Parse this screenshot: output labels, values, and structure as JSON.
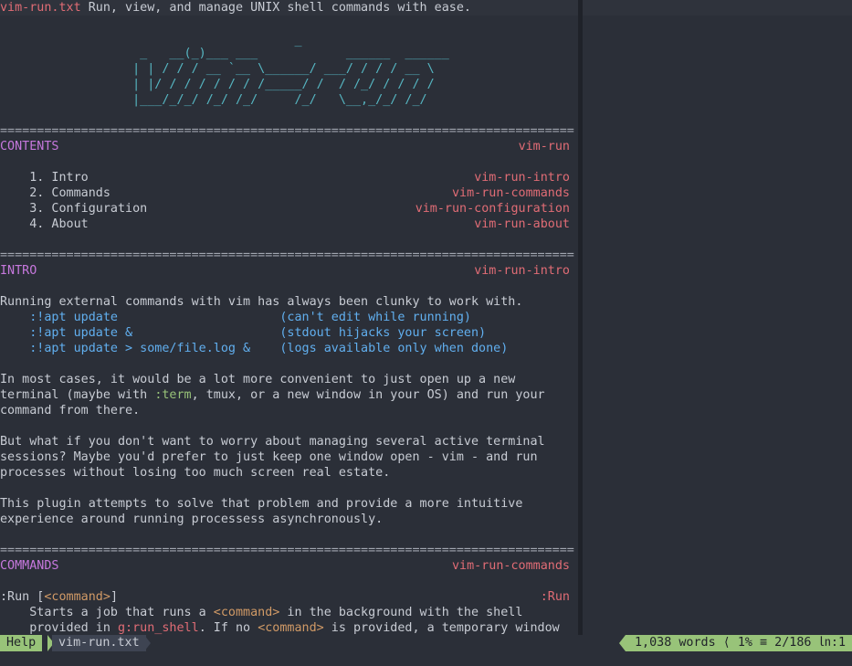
{
  "header": {
    "filename": "vim-run.txt",
    "description": " Run, view, and manage UNIX shell commands with ease."
  },
  "ascii_art": [
    "                                        _",
    "                   _   __(_)___ ___            ______  ______",
    "                  | | / / / __ `__ \\______/ ___/ / / / __ \\",
    "                  | |/ / / / / / / /_____/ /  / /_/ / / / /",
    "                  |___/_/_/ /_/ /_/     /_/   \\__,_/_/ /_/"
  ],
  "separator": "==============================================================================",
  "contents": {
    "title": "CONTENTS",
    "tag": "vim-run",
    "items": [
      {
        "label": "    1. Intro",
        "tag": "vim-run-intro"
      },
      {
        "label": "    2. Commands",
        "tag": "vim-run-commands"
      },
      {
        "label": "    3. Configuration",
        "tag": "vim-run-configuration"
      },
      {
        "label": "    4. About",
        "tag": "vim-run-about"
      }
    ]
  },
  "intro": {
    "title": "INTRO",
    "tag": "vim-run-intro",
    "p1": "Running external commands with vim has always been clunky to work with.",
    "examples": [
      {
        "cmd": "    :!apt update                      ",
        "note": "(can't edit while running)"
      },
      {
        "cmd": "    :!apt update &                    ",
        "note": "(stdout hijacks your screen)"
      },
      {
        "cmd": "    :!apt update > some/file.log &    ",
        "note": "(logs available only when done)"
      }
    ],
    "p2_l1": "In most cases, it would be a lot more convenient to just open up a new",
    "p2_l2_a": "terminal (maybe with ",
    "p2_l2_term": ":term",
    "p2_l2_b": ", tmux, or a new window in your OS) and run your",
    "p2_l3": "command from there.",
    "p3_l1": "But what if you don't want to worry about managing several active terminal",
    "p3_l2": "sessions? Maybe you'd prefer to just keep one window open - vim - and run",
    "p3_l3": "processes without losing too much screen real estate.",
    "p4_l1": "This plugin attempts to solve that problem and provide a more intuitive",
    "p4_l2": "experience around running processess asynchronously."
  },
  "commands": {
    "title": "COMMANDS",
    "tag": "vim-run-commands",
    "run_a": ":Run [",
    "run_arg": "<command>",
    "run_b": "]",
    "run_tag": ":Run",
    "d1_a": "    Starts a job that runs a ",
    "d1_arg": "<command>",
    "d1_b": " in the background with the shell",
    "d2_a": "    provided in ",
    "d2_var": "g:run_shell",
    "d2_b": ". If no ",
    "d2_arg": "<command>",
    "d2_c": " is provided, a temporary window"
  },
  "statusline": {
    "mode": "Help",
    "file": "vim-run.txt",
    "info": "1,038 words ⟨ 1% ≡ 2/186 ㏑:1"
  }
}
